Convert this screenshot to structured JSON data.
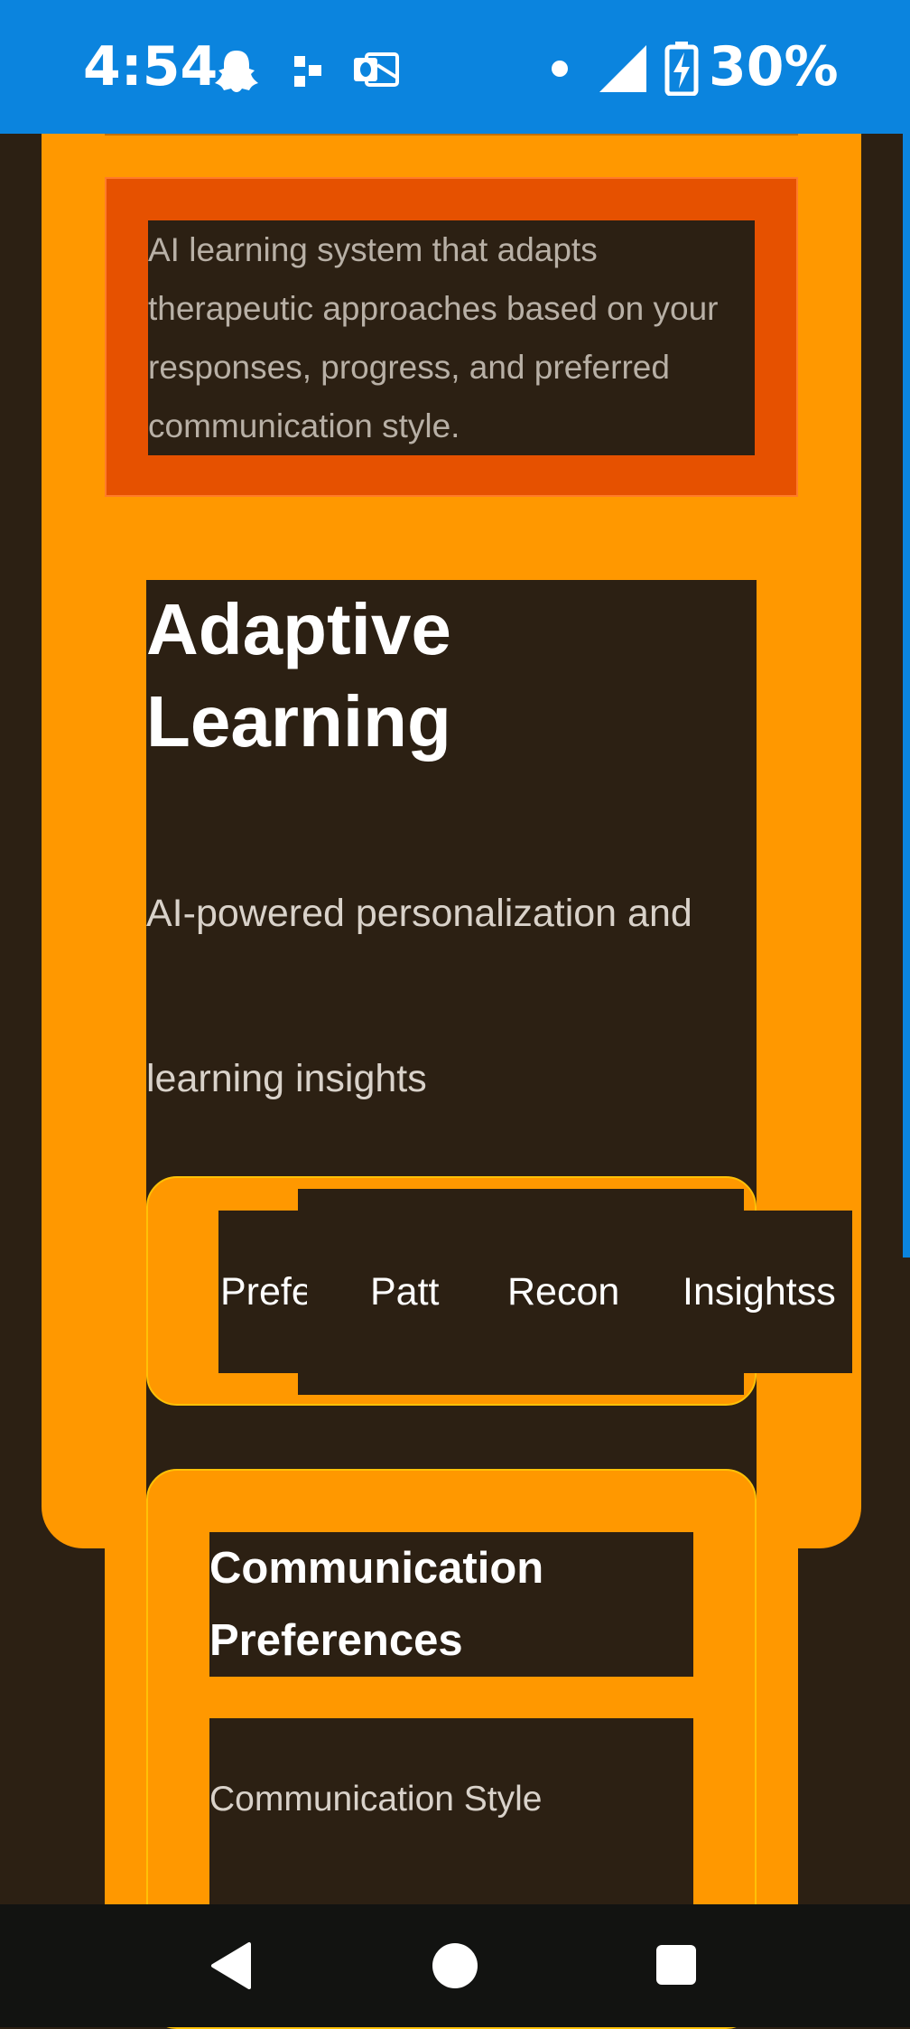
{
  "status_bar": {
    "time": "4:54",
    "battery_percent": "30%",
    "icons": [
      "snapchat-icon",
      "dots-icon",
      "outlook-icon",
      "dot-icon",
      "signal-icon",
      "battery-charging-icon"
    ]
  },
  "description": {
    "text": "AI learning system that adapts therapeutic approaches based on your responses, progress, and preferred communication style."
  },
  "header": {
    "title": "Adaptive Learning",
    "subtitle": "AI-powered personalization and learning insights"
  },
  "tabs": [
    {
      "label": "Prefe"
    },
    {
      "label": "Patt"
    },
    {
      "label": "Recon"
    },
    {
      "label": "Insightss"
    }
  ],
  "preferences_card": {
    "title": "Communication Preferences",
    "field_label": "Communication Style"
  },
  "nav_bar": {
    "icons": [
      "back-icon",
      "home-icon",
      "recents-icon"
    ]
  },
  "colors": {
    "status_bar": "#0b84de",
    "accent_orange": "#ff9800",
    "deep_orange": "#e65100",
    "dark_background": "#2c2013",
    "nav_bar": "#121311"
  }
}
